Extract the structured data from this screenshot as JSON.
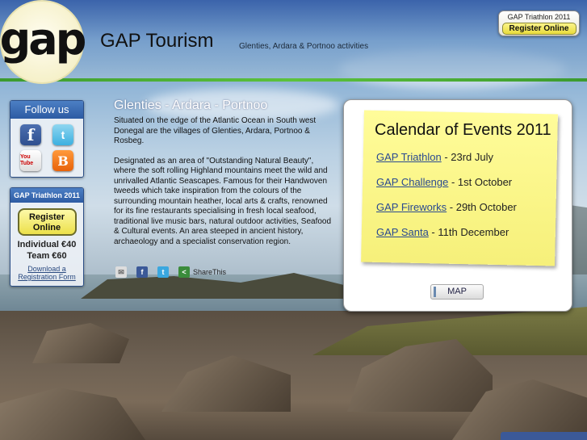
{
  "header": {
    "logo_text": "gap",
    "title": "GAP Tourism",
    "subtitle": "Glenties, Ardara & Portnoo activities",
    "register_box": {
      "title": "GAP Triathlon 2011",
      "button_label": "Register Online"
    }
  },
  "sidebar": {
    "follow_title": "Follow us",
    "social": [
      {
        "name": "facebook-icon",
        "glyph": "f"
      },
      {
        "name": "twitter-icon",
        "glyph": "t"
      },
      {
        "name": "youtube-icon",
        "glyph": "You Tube"
      },
      {
        "name": "blogger-icon",
        "glyph": "B"
      }
    ],
    "triathlon": {
      "title": "GAP Triathlon 2011",
      "register_label": "Register Online",
      "individual": "Individual €40",
      "team": "Team €60",
      "download_label": "Download a Registration Form"
    }
  },
  "main": {
    "title": "Glenties - Ardara - Portnoo",
    "paragraph1": "Situated on the edge of the Atlantic Ocean in South west Donegal are the villages of Glenties, Ardara, Portnoo & Rosbeg.",
    "paragraph2": "Designated as an area of \"Outstanding Natural Beauty\", where the soft rolling Highland mountains meet  the wild and unrivalled Atlantic Seascapes. Famous for their Handwoven tweeds which take inspiration from the colours of the surrounding mountain heather, local arts & crafts, renowned for its fine restaurants specialising in fresh local seafood, traditional live music bars, natural outdoor activities, Seafood & Cultural events. An area steeped in ancient history, archaeology and a specialist conservation region.",
    "share_label": "ShareThis"
  },
  "calendar": {
    "title": "Calendar of Events 2011",
    "events": [
      {
        "name": "GAP Triathlon",
        "date": " - 23rd July"
      },
      {
        "name": "GAP Challenge",
        "date": " - 1st October"
      },
      {
        "name": "GAP Fireworks",
        "date": " - 29th October"
      },
      {
        "name": "GAP Santa",
        "date": " - 11th December"
      }
    ],
    "map_label": "MAP"
  },
  "colors": {
    "header_blue": "#3a62aa",
    "green_rule": "#5cc23c",
    "postit_yellow": "#f6f07a",
    "button_yellow": "#ece04a",
    "panel_blue": "#2d5ba3"
  }
}
